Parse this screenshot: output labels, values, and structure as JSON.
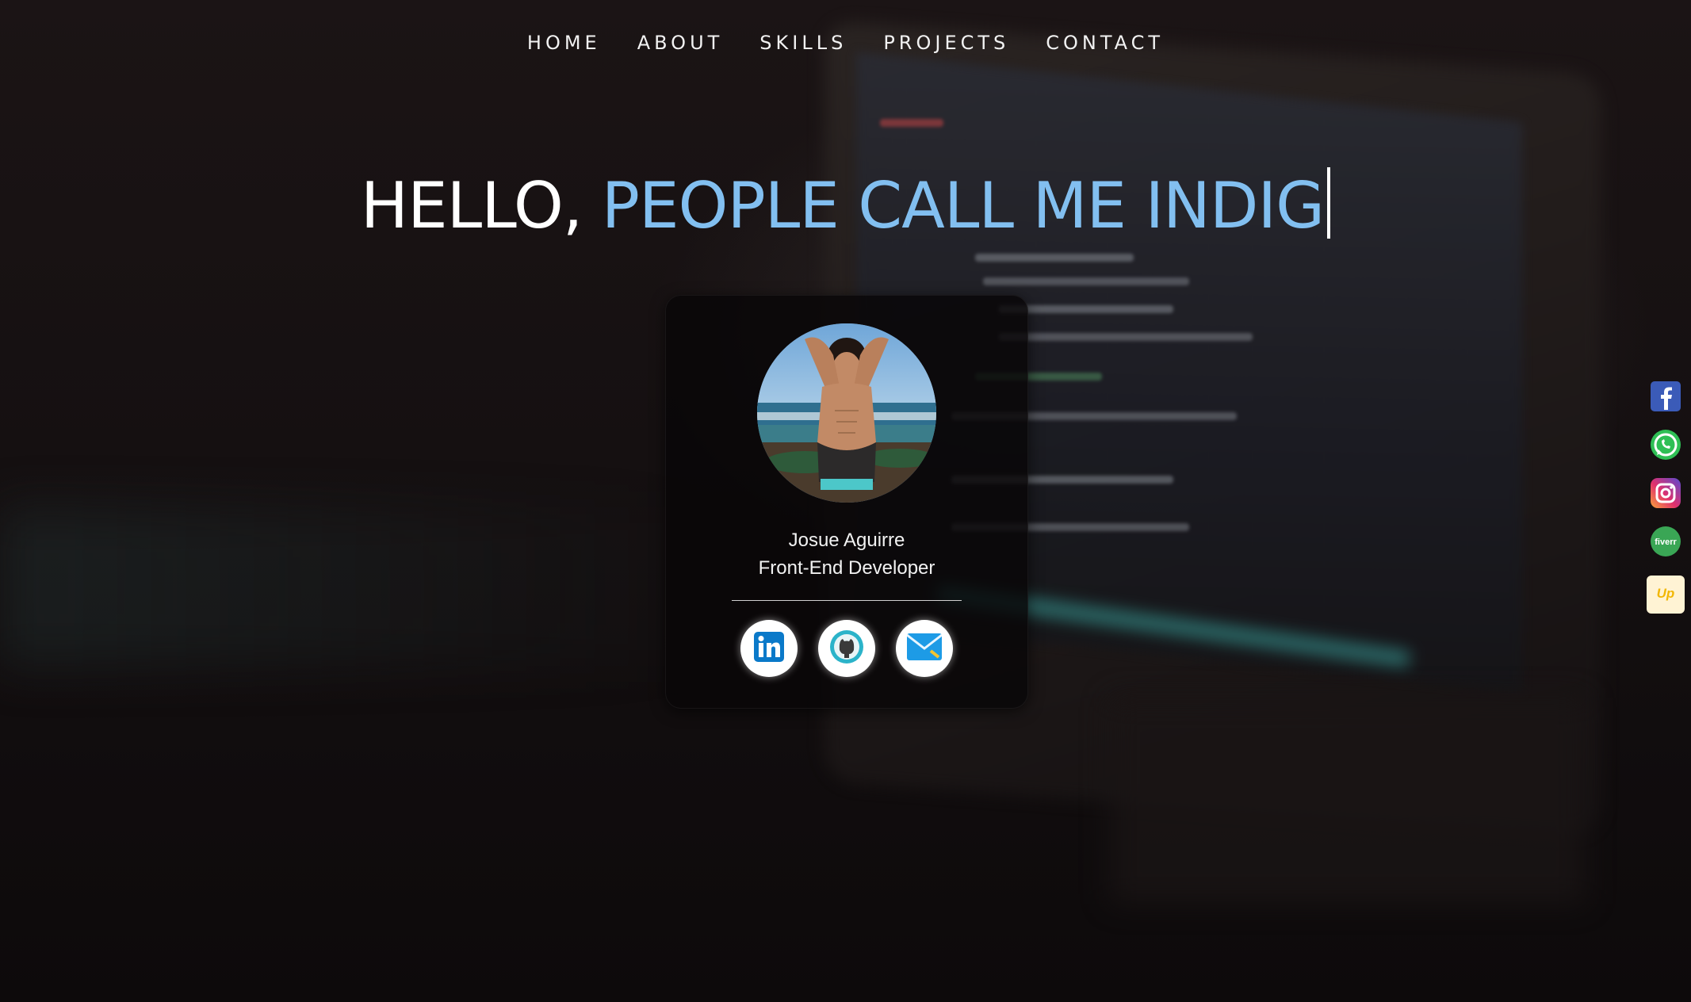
{
  "nav": {
    "items": [
      "HOME",
      "ABOUT",
      "SKILLS",
      "PROJECTS",
      "CONTACT"
    ]
  },
  "hero": {
    "greeting": "HELLO, ",
    "typed_text": "PEOPLE CALL ME INDIG"
  },
  "card": {
    "name": "Josue Aguirre",
    "role": "Front-End Developer",
    "socials": [
      {
        "icon": "linkedin-icon"
      },
      {
        "icon": "github-icon"
      },
      {
        "icon": "mail-icon"
      }
    ]
  },
  "floating_socials": [
    {
      "icon": "facebook-icon"
    },
    {
      "icon": "whatsapp-icon"
    },
    {
      "icon": "instagram-icon"
    },
    {
      "icon": "fiverr-icon",
      "label": "fiverr"
    },
    {
      "icon": "upwork-icon",
      "label": "Up"
    }
  ],
  "colors": {
    "accent": "#82bff0",
    "text": "#ffffff",
    "background": "#150f10"
  }
}
